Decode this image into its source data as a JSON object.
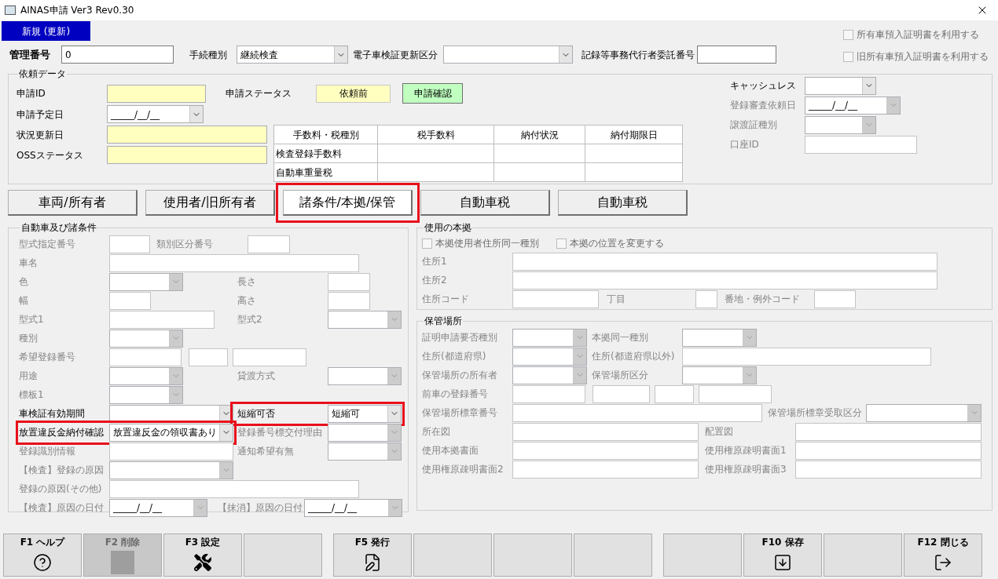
{
  "window": {
    "title": "AINAS申請 Ver3 Rev0.30"
  },
  "mode_badge": "新規 (更新)",
  "header": {
    "fields": [
      {
        "label": "管理番号",
        "kind": "text",
        "value": "0",
        "enabled": true,
        "bold": true
      },
      {
        "label": "手続種別",
        "kind": "select",
        "value": "継続検査",
        "enabled": true,
        "bold": false
      },
      {
        "label": "電子車検証更新区分",
        "kind": "select",
        "enabled": true,
        "bold": false
      },
      {
        "label": "記録等事務代行者委託番号",
        "kind": "text",
        "enabled": true,
        "bold": false
      }
    ],
    "checkboxes": [
      {
        "label": "所有車預入証明書を利用する",
        "checked": false
      },
      {
        "label": "旧所有車預入証明書を利用する",
        "checked": false
      }
    ]
  },
  "request_data": {
    "title": "依頼データ",
    "fields": [
      {
        "label": "申請ID",
        "kind": "readonly",
        "enabled": true
      },
      {
        "label": "申請予定日",
        "kind": "date",
        "value": "_____/__/__",
        "enabled": true
      },
      {
        "label": "状況更新日",
        "kind": "readonly",
        "enabled": true
      },
      {
        "label": "OSSステータス",
        "kind": "readonly",
        "enabled": true
      }
    ],
    "status": {
      "label": "申請ステータス",
      "value": "依頼前"
    },
    "confirm_button": "申請確認",
    "fee_table": {
      "columns": [
        "手数料・税種別",
        "税手数料",
        "納付状況",
        "納付期限日"
      ],
      "rows": [
        {
          "fee_type": "検査登録手数料"
        },
        {
          "fee_type": "自動車重量税"
        }
      ]
    },
    "side_fields": [
      {
        "label": "キャッシュレス",
        "kind": "select",
        "enabled": true
      },
      {
        "label": "登録審査依頼日",
        "kind": "date",
        "value": "_____/__/__",
        "enabled": false
      },
      {
        "label": "譲渡証種別",
        "kind": "select",
        "enabled": false
      },
      {
        "label": "口座ID",
        "kind": "text",
        "enabled": false
      }
    ]
  },
  "tabs": [
    {
      "label": "車両/所有者",
      "selected": false,
      "highlighted": false
    },
    {
      "label": "使用者/旧所有者",
      "selected": false,
      "highlighted": false
    },
    {
      "label": "諸条件/本拠/保管",
      "selected": true,
      "highlighted": true
    },
    {
      "label": "自動車税",
      "selected": false,
      "highlighted": false
    },
    {
      "label": "自動車税",
      "selected": false,
      "highlighted": false
    }
  ],
  "vehicle": {
    "title": "自動車及び諸条件",
    "rows": [
      [
        {
          "label": "型式指定番号",
          "kind": "text",
          "enabled": false,
          "highlighted": false
        },
        {
          "label": "類別区分番号",
          "kind": "text",
          "enabled": false,
          "highlighted": false
        }
      ],
      [
        {
          "label": "車名",
          "kind": "text",
          "enabled": false,
          "highlighted": false
        }
      ],
      [
        {
          "label": "色",
          "kind": "select",
          "enabled": false,
          "highlighted": false
        },
        {
          "label": "長さ",
          "kind": "text",
          "enabled": false,
          "highlighted": false
        }
      ],
      [
        {
          "label": "幅",
          "kind": "text",
          "enabled": false,
          "highlighted": false
        },
        {
          "label": "高さ",
          "kind": "text",
          "enabled": false,
          "highlighted": false
        }
      ],
      [
        {
          "label": "型式1",
          "kind": "text",
          "enabled": false,
          "highlighted": false
        },
        {
          "label": "型式2",
          "kind": "select",
          "enabled": false,
          "highlighted": false
        }
      ],
      [
        {
          "label": "種別",
          "kind": "select",
          "enabled": false,
          "highlighted": false
        }
      ],
      [
        {
          "label": "希望登録番号",
          "kind": "text",
          "enabled": false,
          "highlighted": false
        },
        {
          "kind": "text",
          "enabled": false,
          "highlighted": false
        },
        {
          "kind": "text",
          "enabled": false,
          "highlighted": false
        }
      ],
      [
        {
          "label": "用途",
          "kind": "select",
          "enabled": false,
          "highlighted": false
        },
        {
          "label": "貸渡方式",
          "kind": "select",
          "enabled": false,
          "highlighted": false
        }
      ],
      [
        {
          "label": "標板1",
          "kind": "select",
          "enabled": false,
          "highlighted": false
        }
      ],
      [
        {
          "label": "車検証有効期間",
          "kind": "select",
          "enabled": true,
          "highlighted": false
        },
        {
          "label": "短縮可否",
          "kind": "select",
          "value": "短縮可",
          "enabled": true,
          "highlighted": true
        }
      ],
      [
        {
          "label": "放置違反金納付確認",
          "kind": "select",
          "value": "放置違反金の領収書あり",
          "enabled": true,
          "highlighted": true
        },
        {
          "label": "登録番号標交付理由",
          "kind": "select",
          "enabled": false,
          "highlighted": false
        }
      ],
      [
        {
          "label": "登録識別情報",
          "kind": "text",
          "enabled": false,
          "highlighted": false
        },
        {
          "label": "通知希望有無",
          "kind": "select",
          "enabled": false,
          "highlighted": false
        }
      ],
      [
        {
          "label": "【検査】登録の原因",
          "kind": "select",
          "enabled": false,
          "highlighted": false
        }
      ],
      [
        {
          "label": "登録の原因(その他)",
          "kind": "text",
          "enabled": false,
          "highlighted": false
        }
      ],
      [
        {
          "label": "【検査】原因の日付",
          "kind": "date",
          "value": "_____/__/__",
          "enabled": false,
          "highlighted": false
        },
        {
          "label": "【抹消】原因の日付",
          "kind": "date",
          "value": "_____/__/__",
          "enabled": false,
          "highlighted": false
        }
      ]
    ]
  },
  "base": {
    "title": "使用の本拠",
    "checkboxes": [
      {
        "label": "本拠使用者住所同一種別",
        "checked": false
      },
      {
        "label": "本拠の位置を変更する",
        "checked": false
      }
    ],
    "rows": [
      [
        {
          "label": "住所1",
          "kind": "text",
          "enabled": false
        }
      ],
      [
        {
          "label": "住所2",
          "kind": "text",
          "enabled": false
        }
      ],
      [
        {
          "label": "住所コード",
          "kind": "text",
          "enabled": false
        },
        {
          "label": "丁目",
          "kind": "text",
          "enabled": false
        },
        {
          "label": "番地・例外コード",
          "kind": "text",
          "enabled": false
        }
      ]
    ]
  },
  "storage": {
    "title": "保管場所",
    "rows": [
      [
        {
          "label": "証明申請要否種別",
          "kind": "select",
          "enabled": false
        },
        {
          "label": "本拠同一種別",
          "kind": "select",
          "enabled": false
        }
      ],
      [
        {
          "label": "住所(都道府県)",
          "kind": "select",
          "enabled": false
        },
        {
          "label": "住所(都道府県以外)",
          "kind": "text",
          "enabled": false
        }
      ],
      [
        {
          "label": "保管場所の所有者",
          "kind": "select",
          "enabled": false
        },
        {
          "label": "保管場所区分",
          "kind": "select",
          "enabled": false
        }
      ],
      [
        {
          "label": "前車の登録番号",
          "kind": "text",
          "enabled": false
        },
        {
          "kind": "text",
          "enabled": false
        },
        {
          "kind": "text",
          "enabled": false
        },
        {
          "kind": "text",
          "enabled": false
        }
      ],
      [
        {
          "label": "保管場所標章番号",
          "kind": "text",
          "enabled": false
        },
        {
          "label": "保管場所標章受取区分",
          "kind": "select",
          "enabled": false
        }
      ],
      [
        {
          "label": "所在図",
          "kind": "text",
          "enabled": false
        },
        {
          "label": "配置図",
          "kind": "text",
          "enabled": false
        }
      ],
      [
        {
          "label": "使用本拠書面",
          "kind": "text",
          "enabled": false
        },
        {
          "label": "使用権原疎明書面1",
          "kind": "text",
          "enabled": false
        }
      ],
      [
        {
          "label": "使用権原疎明書面2",
          "kind": "text",
          "enabled": false
        },
        {
          "label": "使用権原疎明書面3",
          "kind": "text",
          "enabled": false
        }
      ]
    ]
  },
  "function_key_groups": [
    [
      {
        "kind": "help",
        "label": "F1 ヘルプ",
        "disabled": false
      },
      {
        "kind": "delete",
        "label": "F2 削除",
        "disabled": true
      },
      {
        "kind": "settings",
        "label": "F3 設定",
        "disabled": false
      },
      {
        "kind": "blank",
        "disabled": false
      }
    ],
    [
      {
        "kind": "issue",
        "label": "F5 発行",
        "disabled": false
      },
      {
        "kind": "blank",
        "disabled": false
      },
      {
        "kind": "blank",
        "disabled": false
      },
      {
        "kind": "blank",
        "disabled": false
      }
    ],
    [
      {
        "kind": "blank",
        "disabled": false
      },
      {
        "kind": "save",
        "label": "F10 保存",
        "disabled": false
      },
      {
        "kind": "blank",
        "disabled": false
      },
      {
        "kind": "close",
        "label": "F12 閉じる",
        "disabled": false
      }
    ]
  ]
}
